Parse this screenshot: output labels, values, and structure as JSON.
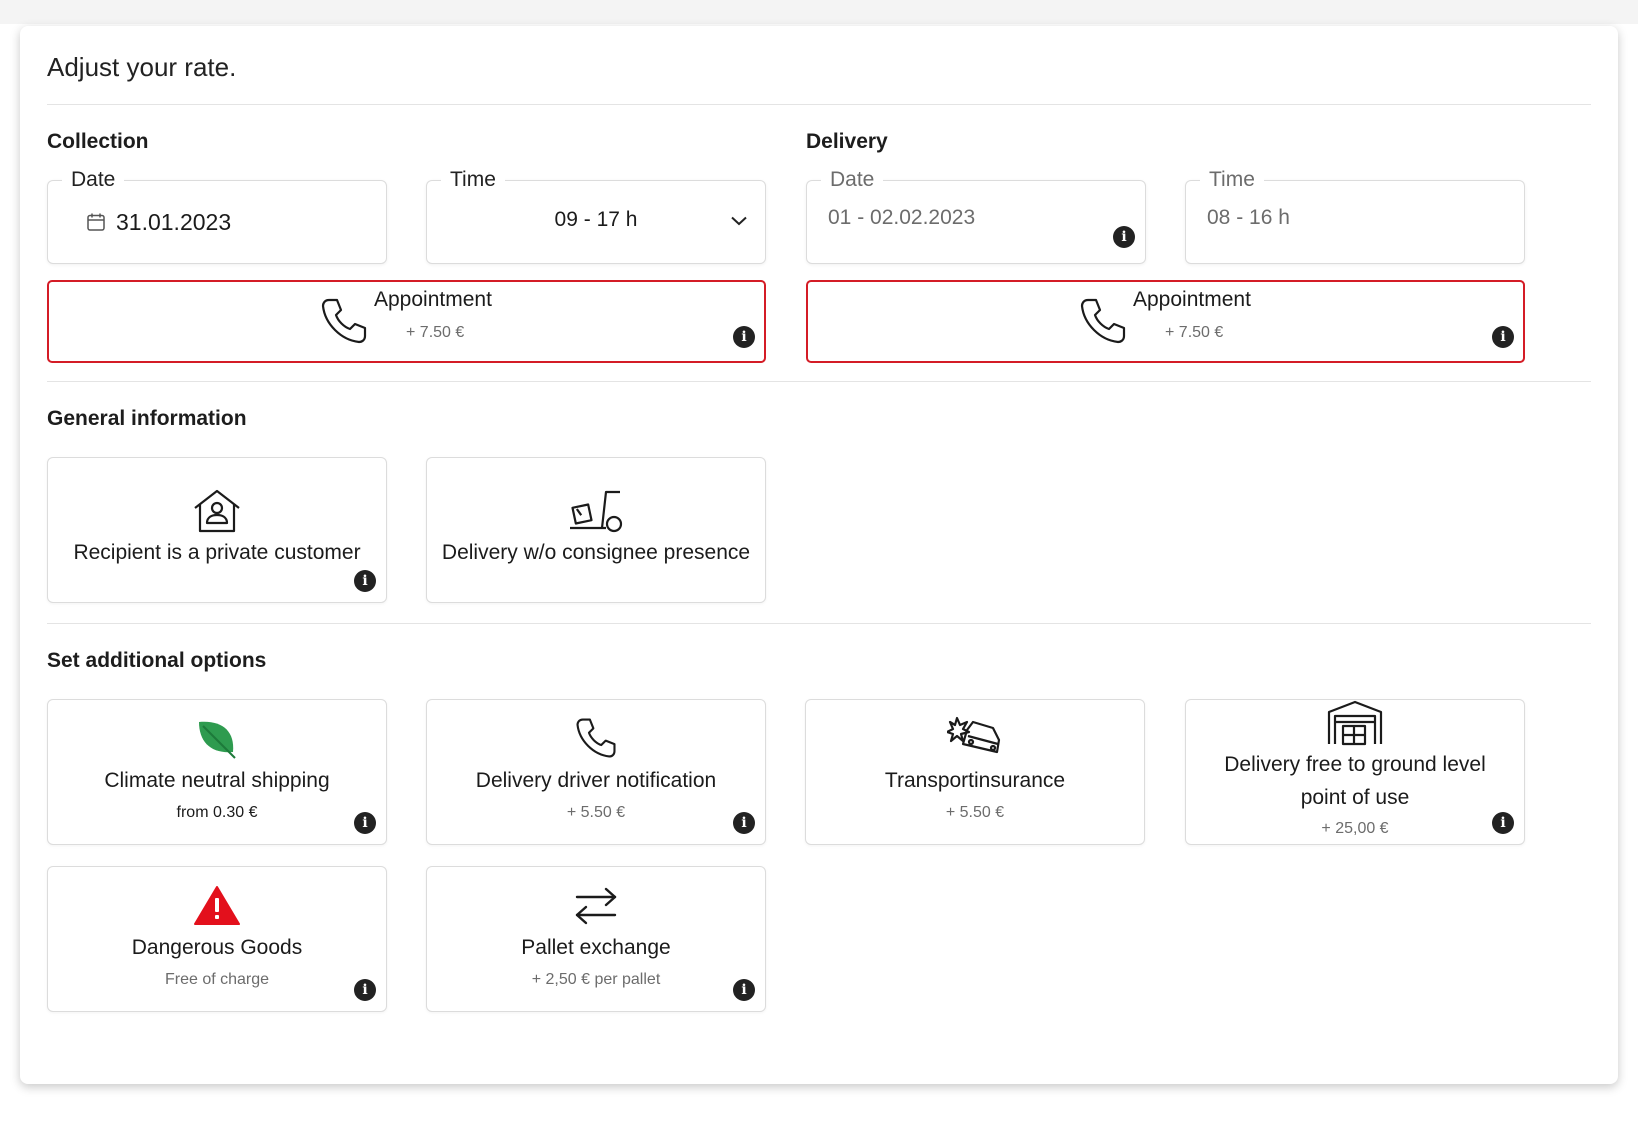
{
  "panel": {
    "title": "Adjust your rate."
  },
  "collection": {
    "title": "Collection",
    "date": {
      "legend": "Date",
      "value": "31.01.2023"
    },
    "time": {
      "legend": "Time",
      "value": "09 - 17 h"
    },
    "appointment": {
      "title": "Appointment",
      "price": "+ 7.50 €"
    }
  },
  "delivery": {
    "title": "Delivery",
    "date": {
      "legend": "Date",
      "value": "01 - 02.02.2023"
    },
    "time": {
      "legend": "Time",
      "value": "08 - 16 h"
    },
    "appointment": {
      "title": "Appointment",
      "price": "+ 7.50 €"
    }
  },
  "general": {
    "title": "General information",
    "cards": [
      {
        "label": "Recipient is a private customer",
        "icon": "house-person-icon"
      },
      {
        "label": "Delivery w/o consignee presence",
        "icon": "hand-truck-icon"
      }
    ]
  },
  "options": {
    "title": "Set additional options",
    "cards": [
      {
        "label": "Climate neutral shipping",
        "sub": "from 0.30 €",
        "icon": "leaf-icon"
      },
      {
        "label": "Delivery driver notification",
        "sub": "+ 5.50 €",
        "icon": "phone-icon"
      },
      {
        "label": "Transportinsurance",
        "sub": "+ 5.50 €",
        "icon": "car-crash-icon"
      },
      {
        "label": "Delivery free to ground level point of use",
        "sub": "+ 25,00 €",
        "icon": "garage-icon"
      },
      {
        "label": "Dangerous Goods",
        "sub": "Free of charge",
        "icon": "warning-icon"
      },
      {
        "label": "Pallet exchange",
        "sub": "+ 2,50 € per pallet",
        "icon": "swap-arrows-icon"
      }
    ]
  },
  "colors": {
    "accent_red": "#d41c26",
    "leaf_green": "#2e9b4f",
    "warning_red": "#e3101c"
  }
}
